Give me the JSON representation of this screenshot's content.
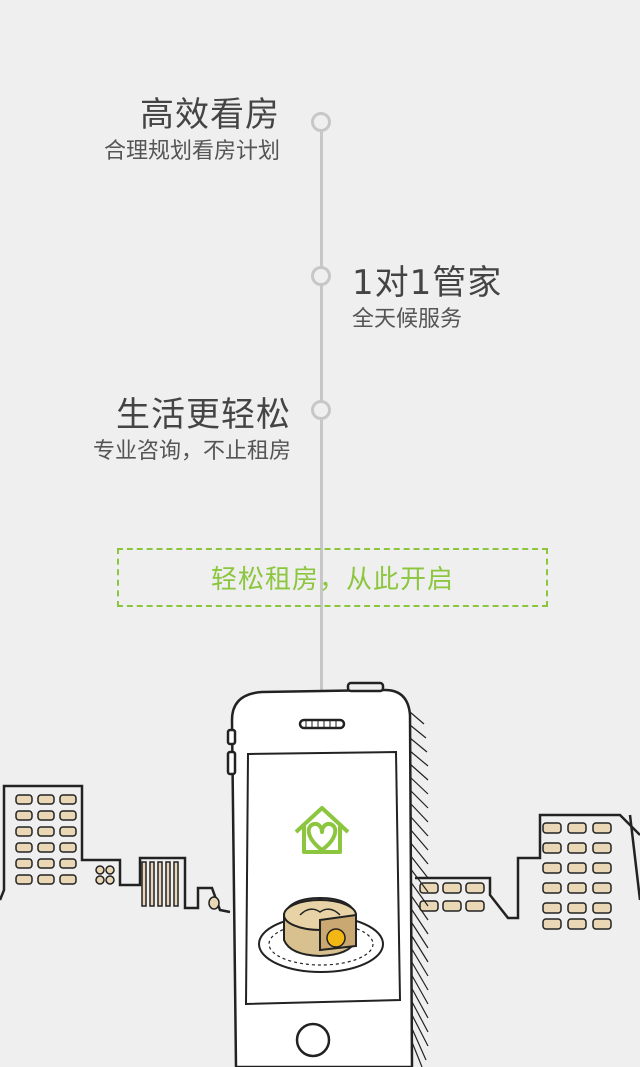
{
  "features": [
    {
      "title": "高效看房",
      "subtitle": "合理规划看房计划"
    },
    {
      "title": "1对1管家",
      "subtitle": "全天候服务"
    },
    {
      "title": "生活更轻松",
      "subtitle": "专业咨询，不止租房"
    }
  ],
  "cta": {
    "label": "轻松租房，从此开启"
  },
  "colors": {
    "accent": "#8cc63f",
    "line": "#c7c7c7",
    "background": "#efefef"
  },
  "illustration": {
    "icons": [
      "phone",
      "house-heart-logo",
      "mooncake",
      "city-buildings"
    ]
  }
}
